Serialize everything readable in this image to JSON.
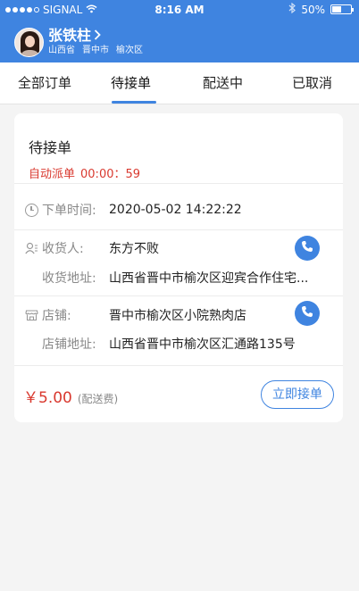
{
  "status_bar": {
    "carrier": "SIGNAL",
    "time": "8:16 AM",
    "battery": "50%",
    "battery_level": 0.5
  },
  "user": {
    "name": "张铁柱",
    "province": "山西省",
    "city": "晋中市",
    "district": "榆次区"
  },
  "tabs": [
    {
      "label": "全部订单",
      "active": false
    },
    {
      "label": "待接单",
      "active": true
    },
    {
      "label": "配送中",
      "active": false
    },
    {
      "label": "已取消",
      "active": false
    }
  ],
  "order": {
    "title": "待接单",
    "auto_label": "自动派单",
    "countdown": "00:00：59",
    "order_time_label": "下单时间:",
    "order_time": "2020-05-02  14:22:22",
    "receiver_label": "收货人:",
    "receiver_name": "东方不败",
    "receiver_addr_label": "收货地址:",
    "receiver_addr": "山西省晋中市榆次区迎宾合作住宅...",
    "store_label": "店铺:",
    "store_name": "晋中市榆次区小院熟肉店",
    "store_addr_label": "店铺地址:",
    "store_addr": "山西省晋中市榆次区汇通路135号",
    "price": "￥5.00",
    "price_note": "(配送费)",
    "accept_label": "立即接单"
  },
  "colors": {
    "accent": "#3f84e0",
    "alert": "#d9392f"
  }
}
